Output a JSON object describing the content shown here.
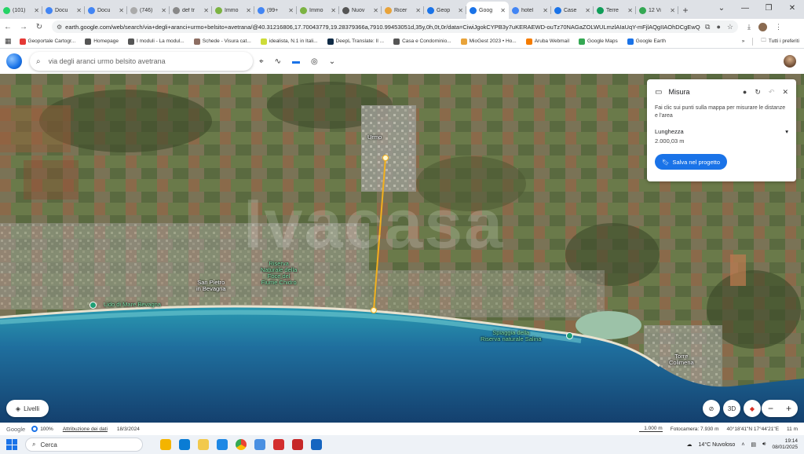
{
  "browser": {
    "tabs": [
      {
        "label": "(101)",
        "color": "#25d366"
      },
      {
        "label": "Docu",
        "color": "#4285f4"
      },
      {
        "label": "Docu",
        "color": "#4285f4"
      },
      {
        "label": "(746)",
        "color": "#aaaaaa"
      },
      {
        "label": "def tr",
        "color": "#888888"
      },
      {
        "label": "Immo",
        "color": "#7cb342"
      },
      {
        "label": "(99+",
        "color": "#4285f4"
      },
      {
        "label": "Immo",
        "color": "#7cb342"
      },
      {
        "label": "Nuov",
        "color": "#555555"
      },
      {
        "label": "Ricer",
        "color": "#e8a33a"
      },
      {
        "label": "Geop",
        "color": "#1a73e8"
      },
      {
        "label": "Goog",
        "color": "#1a73e8",
        "active": true
      },
      {
        "label": "hotel",
        "color": "#4285f4"
      },
      {
        "label": "Case",
        "color": "#1a73e8"
      },
      {
        "label": "Terre",
        "color": "#0f9d58"
      },
      {
        "label": "12 Vi",
        "color": "#34a853"
      }
    ],
    "url": "earth.google.com/web/search/via+degli+aranci+urmo+belsito+avetrana/@40.31216806,17.70043779,19.28379366a,7910.99453051d,35y,0h,0t,0r/data=CiwiJgokCYPB3y7uKERAEWD-ouTz70NAGaZOLWULmzlAIaUqY-mFjlAQgIIAOhDCgEwQgIIAEoNCP___",
    "bookmarks": [
      {
        "label": "Geoportale Cartogr...",
        "color": "#e53935"
      },
      {
        "label": "Homepage",
        "color": "#555555"
      },
      {
        "label": "I moduli - La modul...",
        "color": "#555555"
      },
      {
        "label": "Schede - Visura cat...",
        "color": "#8d6e63"
      },
      {
        "label": "idealista, N.1 in Itali...",
        "color": "#cddc39"
      },
      {
        "label": "DeepL Translate: Il ...",
        "color": "#0f2b46"
      },
      {
        "label": "Casa e Condominio...",
        "color": "#555555"
      },
      {
        "label": "MioGest 2023 • Ho...",
        "color": "#e8a33a"
      },
      {
        "label": "Aruba Webmail",
        "color": "#f57c00"
      },
      {
        "label": "Google Maps",
        "color": "#34a853"
      },
      {
        "label": "Google Earth",
        "color": "#1a73e8"
      }
    ],
    "bookmarks_more": "»",
    "all_bookmarks": "Tutti i preferiti"
  },
  "earth": {
    "search_value": "via degli aranci urmo belsito avetrana"
  },
  "map": {
    "labels": {
      "urmo": "Urmo",
      "san_pietro": "San Pietro\nin Bevagna",
      "riserva_chidro": "Riserva\nNaturale della\nFoce del\nFiume Chidro",
      "riserva_salina": "Spiaggia della\nRiserva naturale Salina",
      "lido": "Lido di Mare Bevagna",
      "torre": "Torre\nColimena"
    }
  },
  "measure": {
    "title": "Misura",
    "description": "Fai clic sui punti sulla mappa per misurare le distanze e l'area",
    "length_label": "Lunghezza",
    "length_value": "2.000,03 m",
    "save_button": "Salva nel progetto"
  },
  "controls": {
    "layers": "Livelli",
    "view3d": "3D"
  },
  "status": {
    "google": "Google",
    "percent": "100%",
    "attribution": "Attribuzione dei dati",
    "date": "18/3/2024",
    "scale": "1.000 m",
    "camera": "Fotocamera: 7.930 m",
    "coords": "40°18'41\"N 17°44'21\"E",
    "altitude": "11 m"
  },
  "taskbar": {
    "search": "Cerca",
    "weather": "14°C  Nuvoloso",
    "time": "19:14",
    "date": "08/01/2025"
  }
}
